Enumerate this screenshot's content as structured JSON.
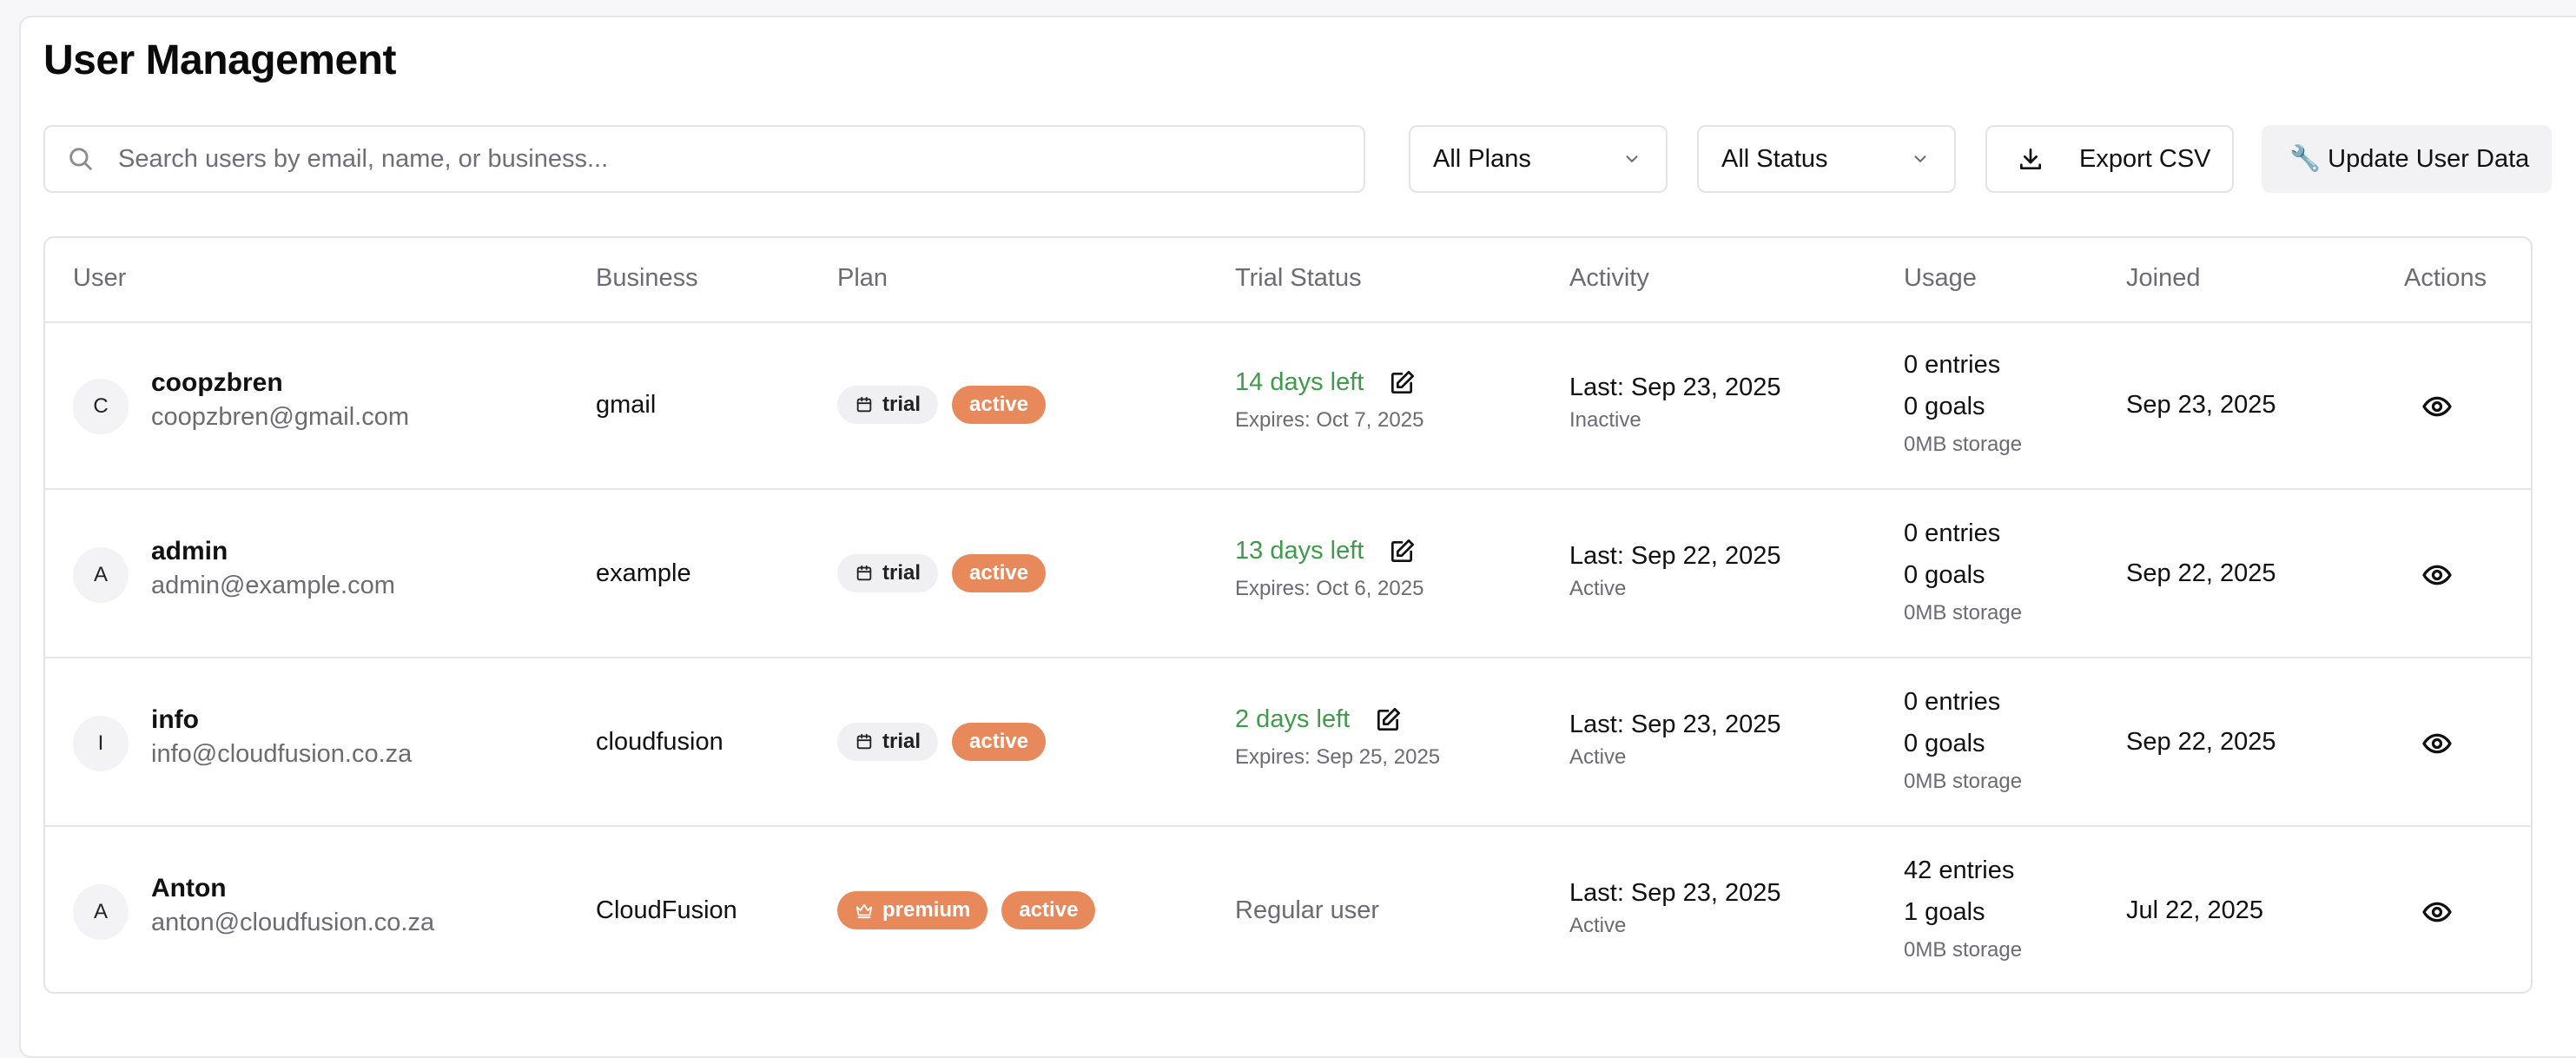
{
  "page": {
    "title": "User Management"
  },
  "toolbar": {
    "search_placeholder": "Search users by email, name, or business...",
    "plan_filter": "All Plans",
    "status_filter": "All Status",
    "export_label": "Export CSV",
    "update_label": "🔧 Update User Data"
  },
  "table": {
    "columns": [
      "User",
      "Business",
      "Plan",
      "Trial Status",
      "Activity",
      "Usage",
      "Joined",
      "Actions"
    ],
    "rows": [
      {
        "initial": "C",
        "name": "coopzbren",
        "email": "coopzbren@gmail.com",
        "business": "gmail",
        "plan": "trial",
        "state": "active",
        "trial_left": "14 days left",
        "expires": "Expires: Oct 7, 2025",
        "regular": "",
        "last": "Last: Sep 23, 2025",
        "activity": "Inactive",
        "entries": "0 entries",
        "goals": "0 goals",
        "storage": "0MB storage",
        "joined": "Sep 23, 2025"
      },
      {
        "initial": "A",
        "name": "admin",
        "email": "admin@example.com",
        "business": "example",
        "plan": "trial",
        "state": "active",
        "trial_left": "13 days left",
        "expires": "Expires: Oct 6, 2025",
        "regular": "",
        "last": "Last: Sep 22, 2025",
        "activity": "Active",
        "entries": "0 entries",
        "goals": "0 goals",
        "storage": "0MB storage",
        "joined": "Sep 22, 2025"
      },
      {
        "initial": "I",
        "name": "info",
        "email": "info@cloudfusion.co.za",
        "business": "cloudfusion",
        "plan": "trial",
        "state": "active",
        "trial_left": "2 days left",
        "expires": "Expires: Sep 25, 2025",
        "regular": "",
        "last": "Last: Sep 23, 2025",
        "activity": "Active",
        "entries": "0 entries",
        "goals": "0 goals",
        "storage": "0MB storage",
        "joined": "Sep 22, 2025"
      },
      {
        "initial": "A",
        "name": "Anton",
        "email": "anton@cloudfusion.co.za",
        "business": "CloudFusion",
        "plan": "premium",
        "state": "active",
        "trial_left": "",
        "expires": "",
        "regular": "Regular user",
        "last": "Last: Sep 23, 2025",
        "activity": "Active",
        "entries": "42 entries",
        "goals": "1 goals",
        "storage": "0MB storage",
        "joined": "Jul 22, 2025"
      }
    ]
  },
  "colors": {
    "accent_orange": "#e8895b",
    "trial_green": "#3f9a4b",
    "muted_text": "#6b6b73",
    "border": "#e3e3e8"
  },
  "icons": {
    "search": "search-icon",
    "chevron": "chevron-down-icon",
    "download": "download-icon",
    "calendar": "calendar-icon",
    "crown": "crown-icon",
    "edit": "edit-icon",
    "view": "eye-icon"
  }
}
